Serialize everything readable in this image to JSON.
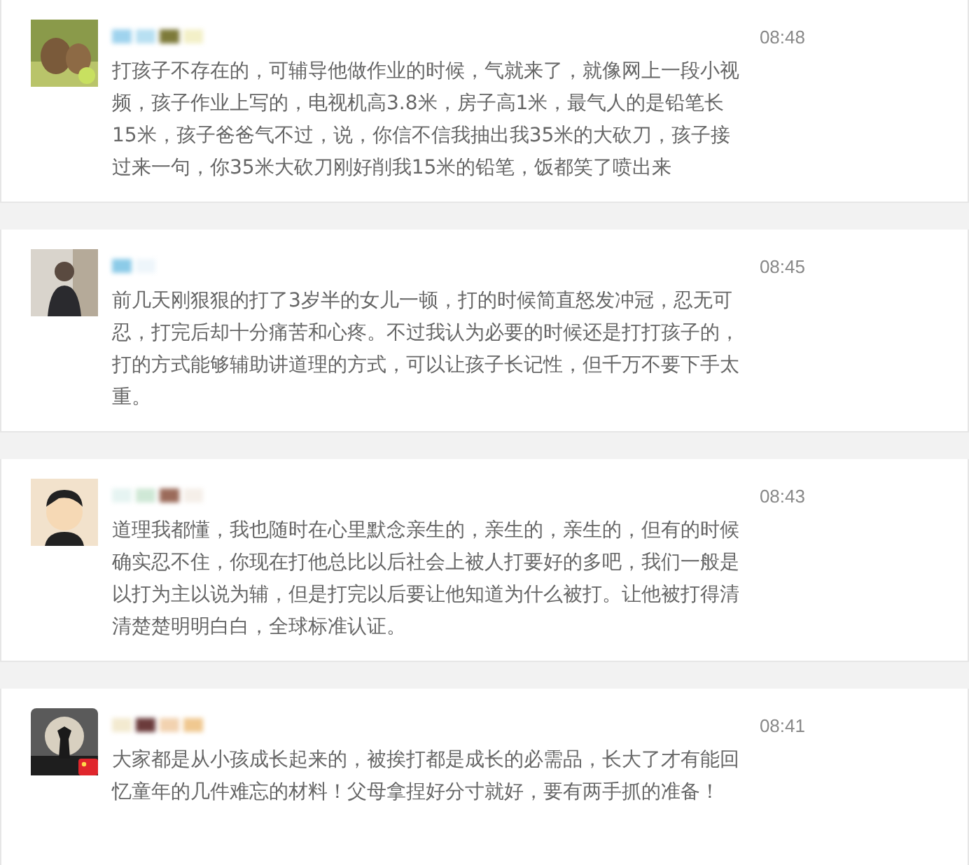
{
  "comments": [
    {
      "time": "08:48",
      "text": "打孩子不存在的，可辅导他做作业的时候，气就来了，就像网上一段小视频，孩子作业上写的，电视机高3.8米，房子高1米，最气人的是铅笔长15米，孩子爸爸气不过，说，你信不信我抽出我35米的大砍刀，孩子接过来一句，你35米大砍刀刚好削我15米的铅笔，饭都笑了喷出来",
      "flag_badge": false
    },
    {
      "time": "08:45",
      "text": "前几天刚狠狠的打了3岁半的女儿一顿，打的时候简直怒发冲冠，忍无可忍，打完后却十分痛苦和心疼。不过我认为必要的时候还是打打孩子的，打的方式能够辅助讲道理的方式，可以让孩子长记性，但千万不要下手太重。",
      "flag_badge": false
    },
    {
      "time": "08:43",
      "text": "道理我都懂，我也随时在心里默念亲生的，亲生的，亲生的，但有的时候确实忍不住，你现在打他总比以后社会上被人打要好的多吧，我们一般是以打为主以说为辅，但是打完以后要让他知道为什么被打。让他被打得清清楚楚明明白白，全球标准认证。",
      "flag_badge": false
    },
    {
      "time": "08:41",
      "text": "大家都是从小孩成长起来的，被挨打都是成长的必需品，长大了才有能回忆童年的几件难忘的材料！父母拿捏好分寸就好，要有两手抓的准备！",
      "flag_badge": true
    }
  ]
}
